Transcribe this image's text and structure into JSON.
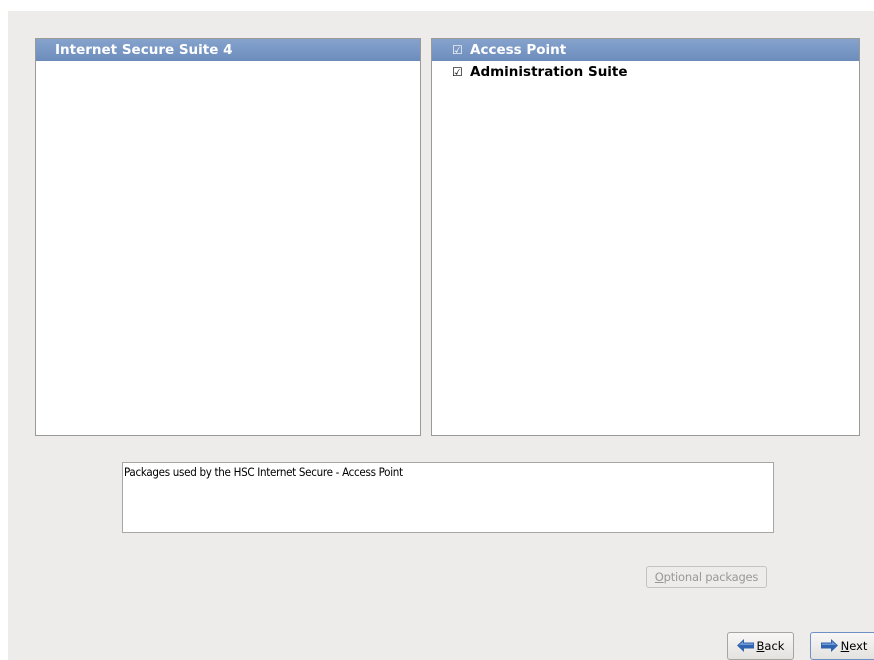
{
  "groups_panel": {
    "items": [
      {
        "label": "Internet Secure Suite 4",
        "selected": true
      }
    ]
  },
  "subgroups_panel": {
    "items": [
      {
        "check": "☑",
        "label": "Access Point",
        "selected": true,
        "checked": true
      },
      {
        "check": "☑",
        "label": "Administration Suite",
        "selected": false,
        "checked": true
      }
    ]
  },
  "description": {
    "text": "Packages used by the HSC Internet Secure - Access Point"
  },
  "buttons": {
    "optional": {
      "mnemonic": "O",
      "rest": "ptional packages",
      "enabled": false
    },
    "back": {
      "mnemonic": "B",
      "rest": "ack",
      "icon": "left-arrow-icon"
    },
    "next": {
      "mnemonic": "N",
      "rest": "ext",
      "icon": "right-arrow-icon"
    }
  },
  "colors": {
    "selection": "#7896c4",
    "window_bg": "#edeceb",
    "arrow_blue": "#2f63b0"
  }
}
